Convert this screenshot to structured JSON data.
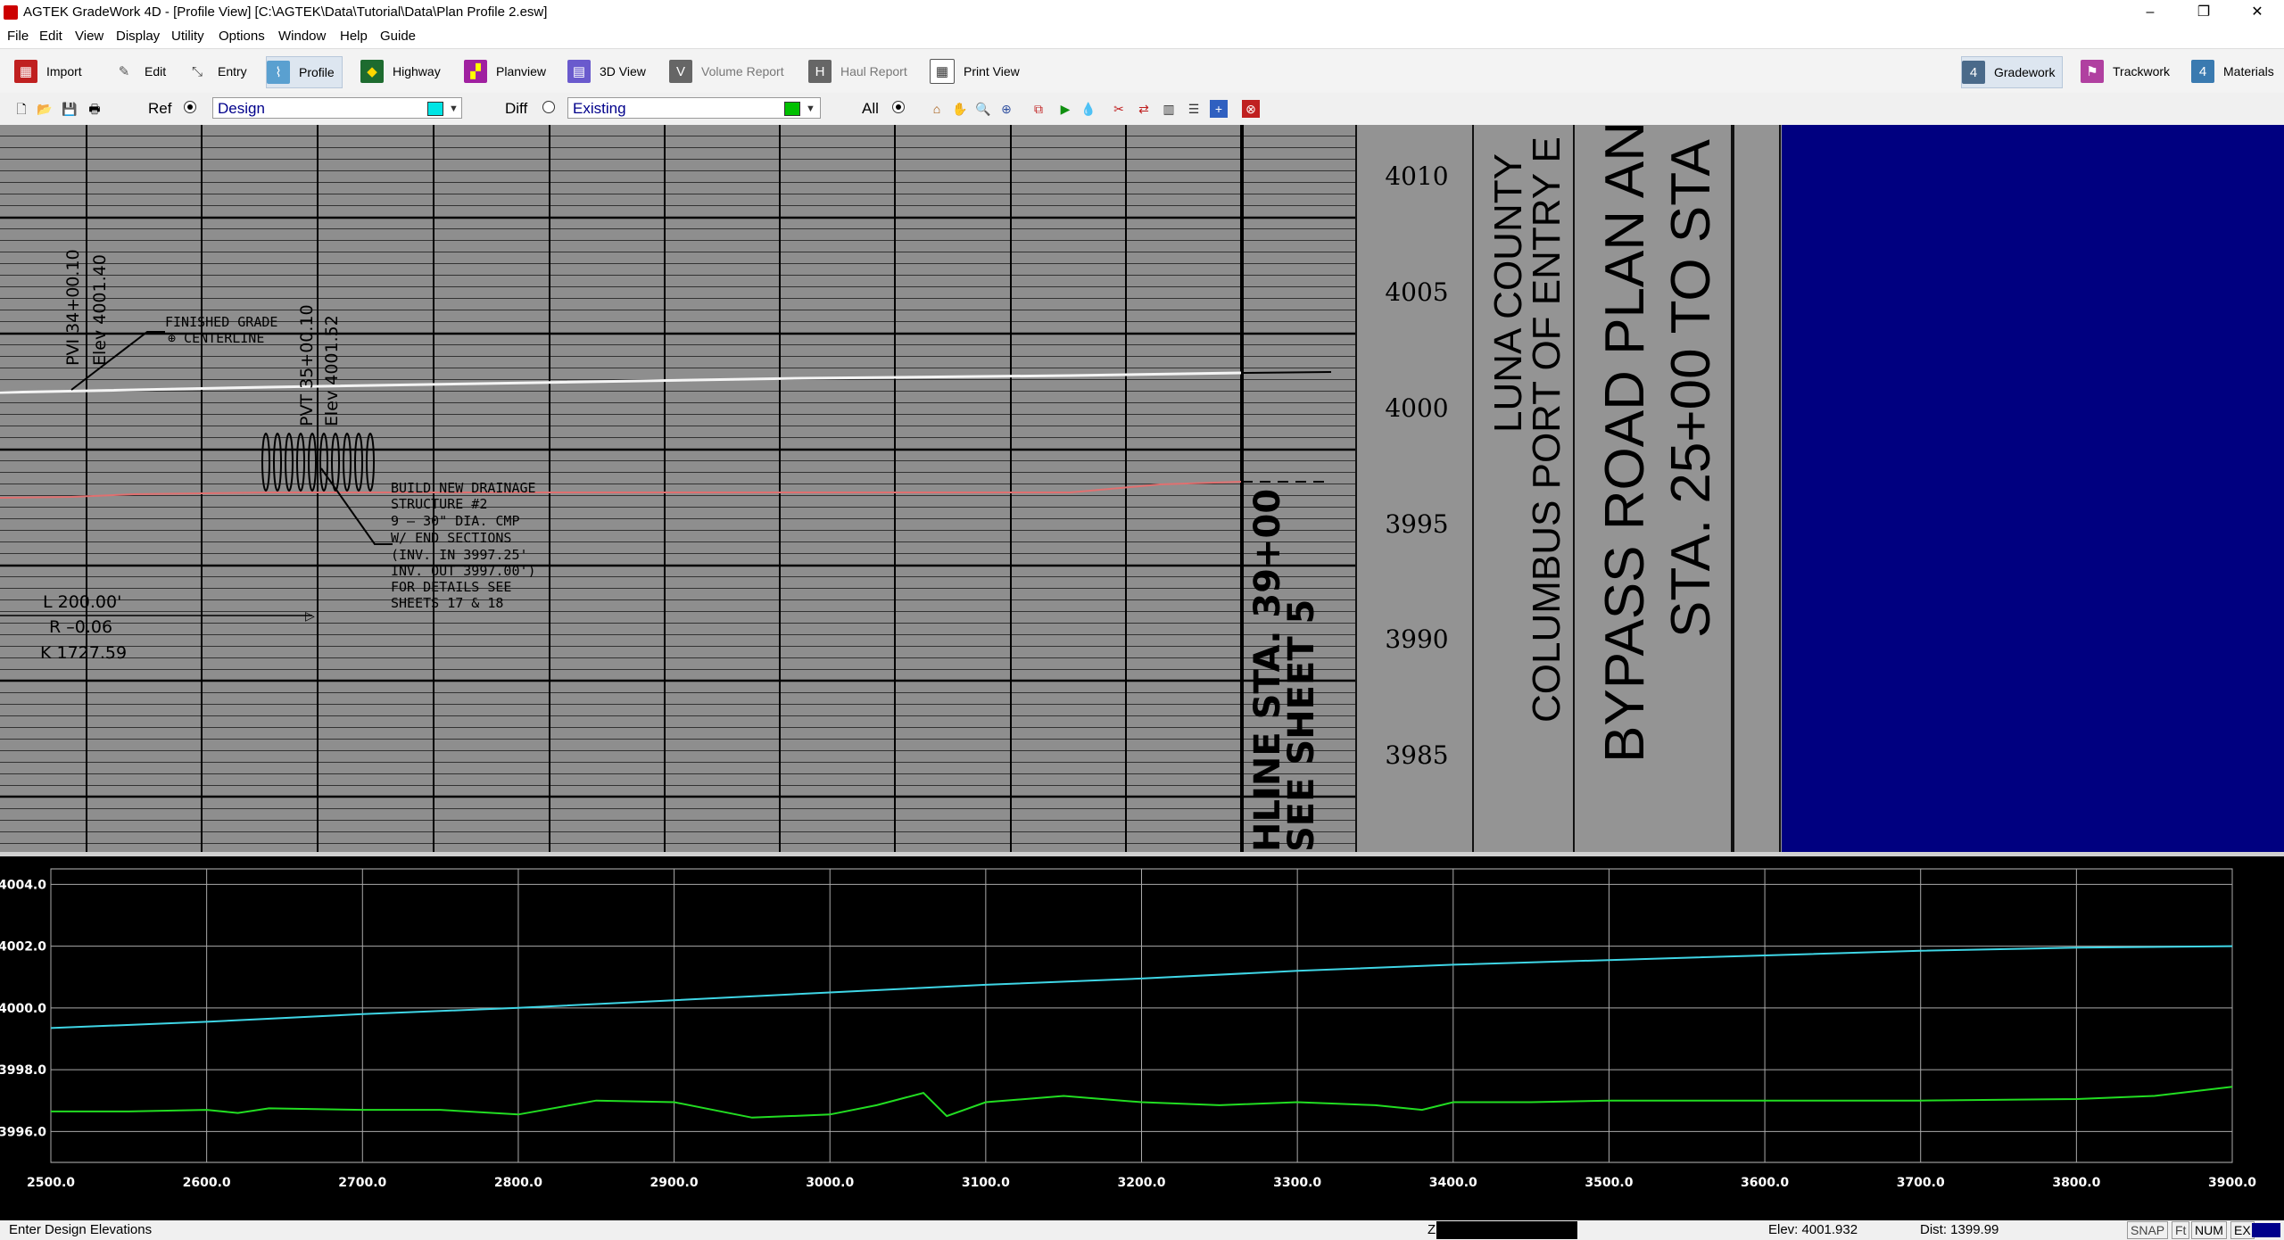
{
  "window": {
    "title": "AGTEK GradeWork 4D - [Profile View]  [C:\\AGTEK\\Data\\Tutorial\\Data\\Plan Profile 2.esw]",
    "minimize": "–",
    "restore": "❐",
    "close": "✕"
  },
  "menu": [
    "File",
    "Edit",
    "View",
    "Display",
    "Utility",
    "Options",
    "Window",
    "Help",
    "Guide"
  ],
  "toolbar": {
    "import": "Import",
    "edit": "Edit",
    "entry": "Entry",
    "profile": "Profile",
    "highway": "Highway",
    "planview": "Planview",
    "view3d": "3D View",
    "volume_report": "Volume Report",
    "haul_report": "Haul Report",
    "print_view": "Print View",
    "gradework": "Gradework",
    "trackwork": "Trackwork",
    "materials": "Materials"
  },
  "surface_bar": {
    "ref_label": "Ref",
    "ref_value": "Design",
    "diff_label": "Diff",
    "diff_value": "Existing",
    "all_label": "All",
    "ref_color": "#00e5e5",
    "diff_color": "#00c000"
  },
  "plan_sheet": {
    "elev_labels": [
      "4010",
      "4005",
      "4000",
      "3995",
      "3990",
      "3985"
    ],
    "pvi_station": "PVI  34+00.10",
    "pvi_elev": "Elev  4001.40",
    "pvt_station": "PVT  35+00.10",
    "pvt_elev": "Elev  4001.52",
    "finished_grade": "FINISHED  GRADE",
    "centerline": "⊕  CENTERLINE",
    "drainage_note": [
      "BUILD NEW DRAINAGE",
      "STRUCTURE #2",
      "9 – 30\" DIA. CMP",
      "W/ END SECTIONS",
      "(INV. IN 3997.25'",
      "INV. OUT 3997.00')",
      "FOR DETAILS SEE",
      "SHEETS 17 & 18"
    ],
    "curve_l": "L  200.00'",
    "curve_r": "R  –0.06",
    "curve_k": "K  1727.59",
    "matchline": "HLINE STA. 39+00",
    "see_sheet": "SEE SHEET 5",
    "title1": "LUNA COUNTY",
    "title2": "COLUMBUS PORT OF ENTRY E",
    "title3": "BYPASS ROAD PLAN AN",
    "title4": "STA. 25+00 TO STA"
  },
  "chart_data": {
    "type": "line",
    "xlim": [
      2500,
      3900
    ],
    "ylim": [
      3995,
      4004.5
    ],
    "x_ticks": [
      "2500.0",
      "2600.0",
      "2700.0",
      "2800.0",
      "2900.0",
      "3000.0",
      "3100.0",
      "3200.0",
      "3300.0",
      "3400.0",
      "3500.0",
      "3600.0",
      "3700.0",
      "3800.0",
      "3900.0"
    ],
    "y_ticks": [
      "3996.0",
      "3998.0",
      "4000.0",
      "4002.0",
      "4004.0"
    ],
    "grid": true,
    "series": [
      {
        "color": "#3fd6e6",
        "x": [
          2500,
          2600,
          2700,
          2800,
          2900,
          3000,
          3100,
          3200,
          3300,
          3400,
          3500,
          3600,
          3700,
          3800,
          3900
        ],
        "y": [
          3999.35,
          3999.55,
          3999.8,
          4000.0,
          4000.25,
          4000.5,
          4000.75,
          4000.95,
          4001.2,
          4001.4,
          4001.55,
          4001.7,
          4001.85,
          4001.95,
          4002.0
        ]
      },
      {
        "color": "#22dd22",
        "x": [
          2500,
          2550,
          2600,
          2620,
          2640,
          2700,
          2750,
          2800,
          2850,
          2900,
          2950,
          3000,
          3030,
          3060,
          3075,
          3100,
          3150,
          3200,
          3250,
          3300,
          3350,
          3380,
          3400,
          3450,
          3500,
          3600,
          3700,
          3800,
          3850,
          3900
        ],
        "y": [
          3996.65,
          3996.65,
          3996.7,
          3996.6,
          3996.75,
          3996.7,
          3996.7,
          3996.55,
          3997.0,
          3996.95,
          3996.45,
          3996.55,
          3996.85,
          3997.25,
          3996.5,
          3996.95,
          3997.15,
          3996.95,
          3996.85,
          3996.95,
          3996.85,
          3996.7,
          3996.95,
          3996.95,
          3997.0,
          3997.0,
          3997.0,
          3997.05,
          3997.15,
          3997.45
        ]
      }
    ]
  },
  "status": {
    "message": "Enter Design Elevations",
    "z_label": "Z",
    "elev": "Elev: 4001.932",
    "dist": "Dist: 1399.99",
    "snap": "SNAP",
    "ft": "Ft",
    "num": "NUM",
    "ex": "EX"
  }
}
